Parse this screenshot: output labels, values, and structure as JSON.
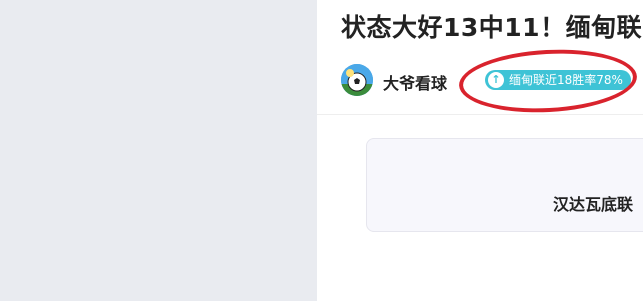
{
  "article": {
    "title": "状态大好13中11！缅甸联",
    "author": {
      "name": "大爷看球",
      "avatar_icon": "soccer-ball-avatar-icon"
    },
    "badge": {
      "label": "缅甸联近18胜率78%",
      "icon": "arrow-up-icon",
      "color": "#3ec3d6"
    },
    "badge2": {
      "icon": "fire-icon",
      "color": "#f5a06b"
    },
    "card": {
      "text": "汉达瓦底联"
    }
  },
  "annotation": {
    "ellipse_color": "#d9232d"
  }
}
